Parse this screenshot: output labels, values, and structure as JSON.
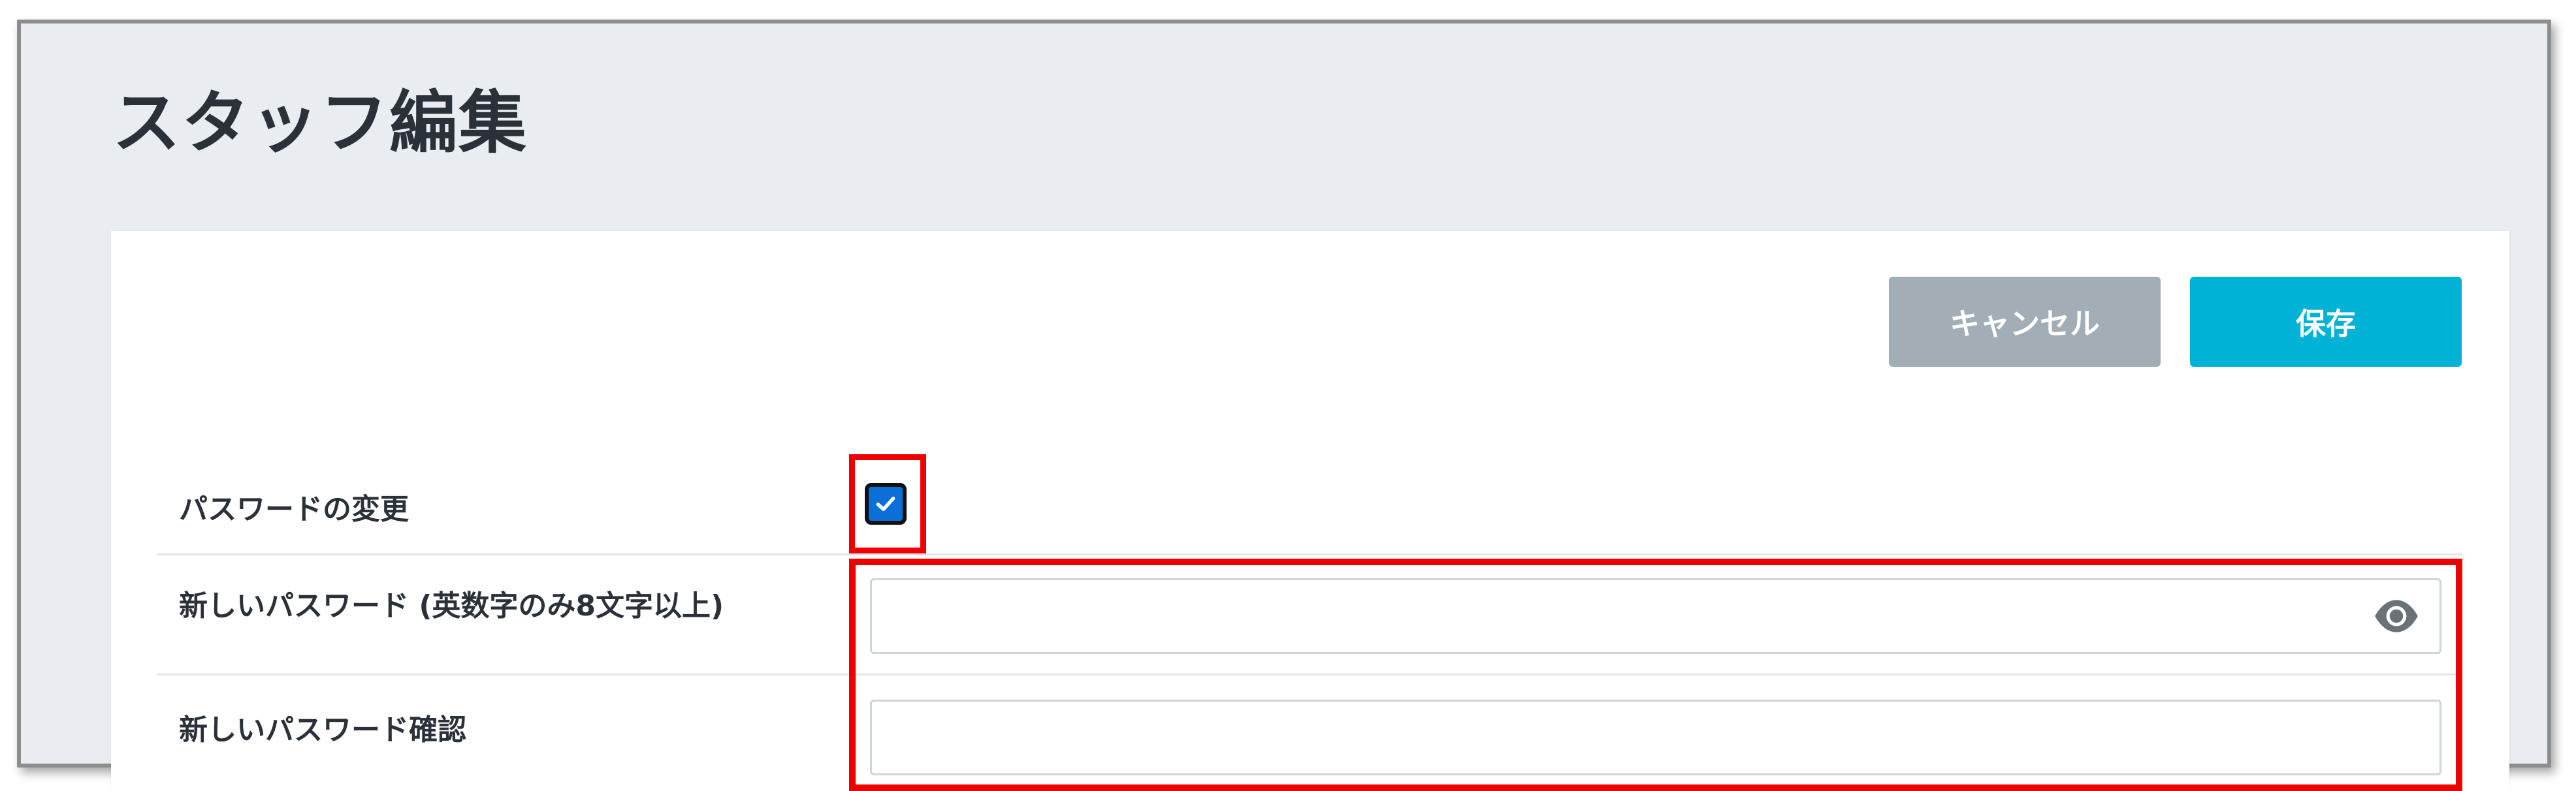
{
  "page": {
    "title": "スタッフ編集"
  },
  "toolbar": {
    "cancel_label": "キャンセル",
    "save_label": "保存"
  },
  "form": {
    "change_password_label": "パスワードの変更",
    "change_password_checked": true,
    "new_password_label": "新しいパスワード (英数字のみ8文字以上)",
    "new_password_value": "",
    "confirm_password_label": "新しいパスワード確認",
    "confirm_password_value": ""
  },
  "icons": {
    "checkbox": "check-icon",
    "visibility": "eye-icon"
  },
  "colors": {
    "save_button": "#00b2d6",
    "cancel_button": "#a3adb5",
    "highlight": "#ee0000",
    "checkbox": "#0a70d8",
    "background": "#e9ecf0"
  }
}
